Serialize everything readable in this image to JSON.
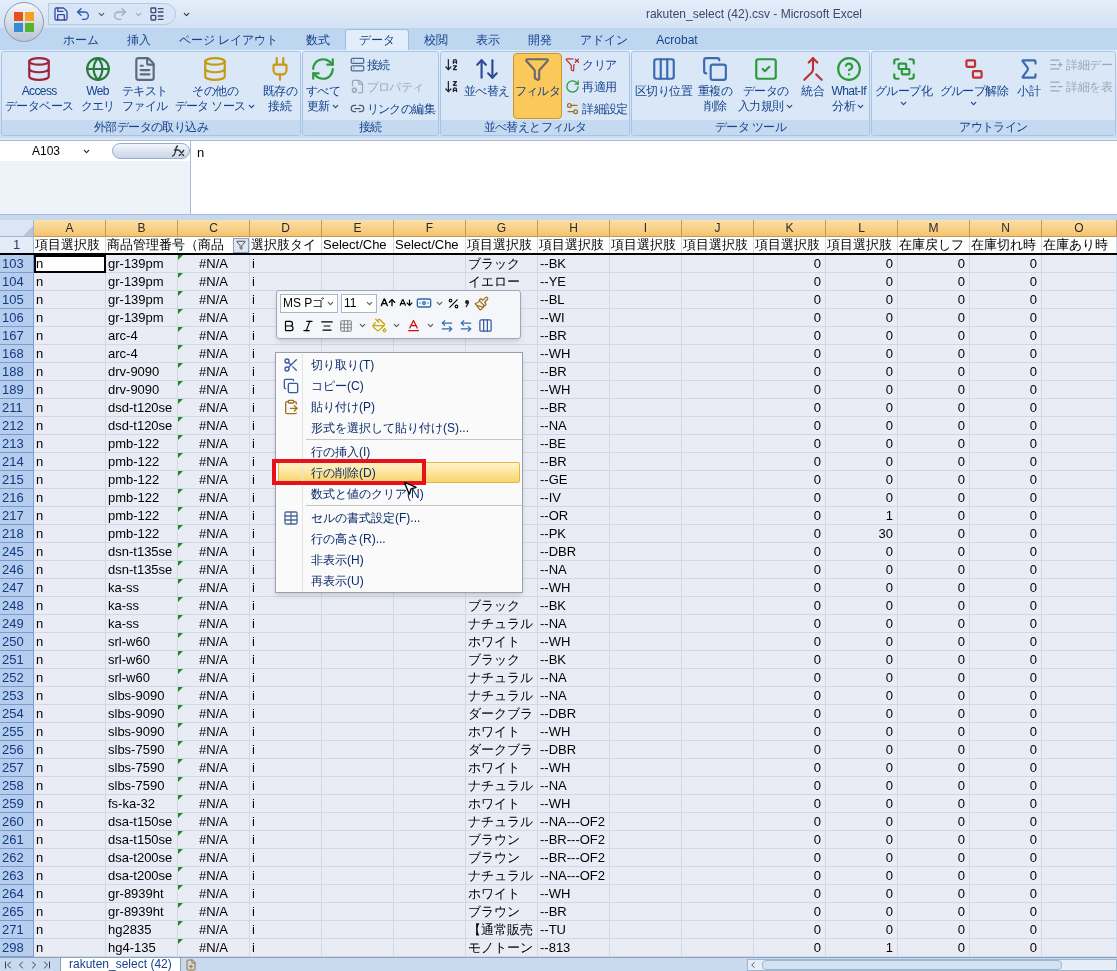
{
  "window": {
    "title": "rakuten_select (42).csv - Microsoft Excel"
  },
  "ribbon": {
    "tabs": [
      {
        "label": "ホーム",
        "selected": false
      },
      {
        "label": "挿入",
        "selected": false
      },
      {
        "label": "ページ レイアウト",
        "selected": false
      },
      {
        "label": "数式",
        "selected": false
      },
      {
        "label": "データ",
        "selected": true
      },
      {
        "label": "校閲",
        "selected": false
      },
      {
        "label": "表示",
        "selected": false
      },
      {
        "label": "開発",
        "selected": false
      },
      {
        "label": "アドイン",
        "selected": false
      },
      {
        "label": "Acrobat",
        "selected": false
      }
    ],
    "groups": [
      {
        "label": "外部データの取り込み",
        "buttons": [
          {
            "kind": "large",
            "lines": [
              "Access",
              "データベース"
            ],
            "dropdown": false,
            "disabled": false,
            "selected": false
          },
          {
            "kind": "large",
            "lines": [
              "Web",
              "クエリ"
            ],
            "dropdown": false,
            "disabled": false,
            "selected": false
          },
          {
            "kind": "large",
            "lines": [
              "テキスト",
              "ファイル"
            ],
            "dropdown": false,
            "disabled": false,
            "selected": false
          },
          {
            "kind": "large",
            "lines": [
              "その他の",
              "データ ソース"
            ],
            "dropdown": true,
            "disabled": false,
            "selected": false
          },
          {
            "kind": "large",
            "lines": [
              "既存の",
              "接続"
            ],
            "dropdown": false,
            "disabled": false,
            "selected": false
          }
        ]
      },
      {
        "label": "接続",
        "buttons": [
          {
            "kind": "large",
            "lines": [
              "すべて",
              "更新"
            ],
            "dropdown": true,
            "disabled": false,
            "selected": false
          },
          {
            "kind": "small",
            "lines": [
              "接続"
            ],
            "dropdown": false,
            "disabled": false,
            "selected": false
          },
          {
            "kind": "small",
            "lines": [
              "プロパティ"
            ],
            "dropdown": false,
            "disabled": true,
            "selected": false
          },
          {
            "kind": "small",
            "lines": [
              "リンクの編集"
            ],
            "dropdown": false,
            "disabled": false,
            "selected": false
          }
        ]
      },
      {
        "label": "並べ替えとフィルタ",
        "buttons": [
          {
            "kind": "small",
            "dropdown": false,
            "disabled": false,
            "selected": false
          },
          {
            "kind": "small",
            "dropdown": false,
            "disabled": false,
            "selected": false
          },
          {
            "kind": "large",
            "lines": [
              "並べ替え"
            ],
            "dropdown": false,
            "disabled": false,
            "selected": false
          },
          {
            "kind": "large",
            "lines": [
              "フィルタ"
            ],
            "dropdown": false,
            "disabled": false,
            "selected": true
          },
          {
            "kind": "small",
            "lines": [
              "クリア"
            ],
            "dropdown": false,
            "disabled": false,
            "selected": false
          },
          {
            "kind": "small",
            "lines": [
              "再適用"
            ],
            "dropdown": false,
            "disabled": false,
            "selected": false
          },
          {
            "kind": "small",
            "lines": [
              "詳細設定"
            ],
            "dropdown": false,
            "disabled": false,
            "selected": false
          }
        ]
      },
      {
        "label": "データ ツール",
        "buttons": [
          {
            "kind": "large",
            "lines": [
              "区切り位置"
            ],
            "dropdown": false,
            "disabled": false,
            "selected": false
          },
          {
            "kind": "large",
            "lines": [
              "重複の",
              "削除"
            ],
            "dropdown": false,
            "disabled": false,
            "selected": false
          },
          {
            "kind": "large",
            "lines": [
              "データの",
              "入力規則"
            ],
            "dropdown": true,
            "disabled": false,
            "selected": false
          },
          {
            "kind": "large",
            "lines": [
              "統合"
            ],
            "dropdown": false,
            "disabled": false,
            "selected": false
          },
          {
            "kind": "large",
            "lines": [
              "What-If",
              "分析"
            ],
            "dropdown": true,
            "disabled": false,
            "selected": false
          }
        ]
      },
      {
        "label": "アウトライン",
        "buttons": [
          {
            "kind": "large",
            "lines": [
              "グループ化"
            ],
            "dropdown": true,
            "disabled": false,
            "selected": false
          },
          {
            "kind": "large",
            "lines": [
              "グループ解除"
            ],
            "dropdown": true,
            "disabled": false,
            "selected": false
          },
          {
            "kind": "large",
            "lines": [
              "小計"
            ],
            "dropdown": false,
            "disabled": false,
            "selected": false
          },
          {
            "kind": "small",
            "lines": [
              "詳細デー"
            ],
            "dropdown": false,
            "disabled": true,
            "selected": false
          },
          {
            "kind": "small",
            "lines": [
              "詳細を表"
            ],
            "dropdown": false,
            "disabled": true,
            "selected": false
          }
        ]
      }
    ]
  },
  "formula_bar": {
    "name_box": "A103",
    "value": "n"
  },
  "columns": [
    {
      "label": "A",
      "selected": true
    },
    {
      "label": "B",
      "selected": true
    },
    {
      "label": "C",
      "selected": true
    },
    {
      "label": "D",
      "selected": true
    },
    {
      "label": "E",
      "selected": true
    },
    {
      "label": "F",
      "selected": true
    },
    {
      "label": "G",
      "selected": true
    },
    {
      "label": "H",
      "selected": true
    },
    {
      "label": "I",
      "selected": true
    },
    {
      "label": "J",
      "selected": true
    },
    {
      "label": "K",
      "selected": true
    },
    {
      "label": "L",
      "selected": true
    },
    {
      "label": "M",
      "selected": true
    },
    {
      "label": "N",
      "selected": true
    },
    {
      "label": "O",
      "selected": true
    }
  ],
  "header_row": {
    "num": "1",
    "cells": [
      {
        "text": "項目選択肢",
        "filter": false
      },
      {
        "text": "商品管理番号（商品",
        "filter": false
      },
      {
        "filter": true
      },
      {
        "text": "選択肢タイ",
        "filter": false
      },
      {
        "text": "Select/Che",
        "filter": false
      },
      {
        "text": "Select/Che",
        "filter": false
      },
      {
        "text": "項目選択肢",
        "filter": false
      },
      {
        "text": "項目選択肢",
        "filter": false
      },
      {
        "text": "項目選択肢",
        "filter": false
      },
      {
        "text": "項目選択肢",
        "filter": false
      },
      {
        "text": "項目選択肢",
        "filter": false
      },
      {
        "text": "項目選択肢",
        "filter": false
      },
      {
        "text": "在庫戻しフ",
        "filter": false
      },
      {
        "text": "在庫切れ時",
        "filter": false
      },
      {
        "text": "在庫あり時",
        "filter": false
      }
    ]
  },
  "rows": [
    {
      "num": "103",
      "selected": true,
      "active": true,
      "a": "n",
      "b": "gr-139pm",
      "c": "#N/A",
      "d": "i",
      "g": "ブラック",
      "h": "--BK",
      "k": "0",
      "l": "0",
      "m": "0",
      "n": "0"
    },
    {
      "num": "104",
      "selected": true,
      "active": false,
      "a": "n",
      "b": "gr-139pm",
      "c": "#N/A",
      "d": "i",
      "g": "イエロー",
      "h": "--YE",
      "k": "0",
      "l": "0",
      "m": "0",
      "n": "0"
    },
    {
      "num": "105",
      "selected": true,
      "active": false,
      "a": "n",
      "b": "gr-139pm",
      "c": "#N/A",
      "d": "i",
      "h": "--BL",
      "k": "0",
      "l": "0",
      "m": "0",
      "n": "0"
    },
    {
      "num": "106",
      "selected": true,
      "active": false,
      "a": "n",
      "b": "gr-139pm",
      "c": "#N/A",
      "d": "i",
      "h": "--WI",
      "k": "0",
      "l": "0",
      "m": "0",
      "n": "0"
    },
    {
      "num": "167",
      "selected": true,
      "active": false,
      "a": "n",
      "b": "arc-4",
      "c": "#N/A",
      "d": "i",
      "h": "--BR",
      "k": "0",
      "l": "0",
      "m": "0",
      "n": "0"
    },
    {
      "num": "168",
      "selected": true,
      "active": false,
      "a": "n",
      "b": "arc-4",
      "c": "#N/A",
      "d": "i",
      "h": "--WH",
      "k": "0",
      "l": "0",
      "m": "0",
      "n": "0"
    },
    {
      "num": "188",
      "selected": true,
      "active": false,
      "a": "n",
      "b": "drv-9090",
      "c": "#N/A",
      "d": "i",
      "h": "--BR",
      "k": "0",
      "l": "0",
      "m": "0",
      "n": "0"
    },
    {
      "num": "189",
      "selected": true,
      "active": false,
      "a": "n",
      "b": "drv-9090",
      "c": "#N/A",
      "d": "i",
      "h": "--WH",
      "k": "0",
      "l": "0",
      "m": "0",
      "n": "0"
    },
    {
      "num": "211",
      "selected": true,
      "active": false,
      "a": "n",
      "b": "dsd-t120se",
      "c": "#N/A",
      "d": "i",
      "h": "--BR",
      "k": "0",
      "l": "0",
      "m": "0",
      "n": "0"
    },
    {
      "num": "212",
      "selected": true,
      "active": false,
      "a": "n",
      "b": "dsd-t120se",
      "c": "#N/A",
      "d": "i",
      "h": "--NA",
      "k": "0",
      "l": "0",
      "m": "0",
      "n": "0"
    },
    {
      "num": "213",
      "selected": true,
      "active": false,
      "a": "n",
      "b": "pmb-122",
      "c": "#N/A",
      "d": "i",
      "h": "--BE",
      "k": "0",
      "l": "0",
      "m": "0",
      "n": "0"
    },
    {
      "num": "214",
      "selected": true,
      "active": false,
      "a": "n",
      "b": "pmb-122",
      "c": "#N/A",
      "d": "i",
      "h": "--BR",
      "k": "0",
      "l": "0",
      "m": "0",
      "n": "0"
    },
    {
      "num": "215",
      "selected": true,
      "active": false,
      "a": "n",
      "b": "pmb-122",
      "c": "#N/A",
      "d": "i",
      "h": "--GE",
      "k": "0",
      "l": "0",
      "m": "0",
      "n": "0"
    },
    {
      "num": "216",
      "selected": true,
      "active": false,
      "a": "n",
      "b": "pmb-122",
      "c": "#N/A",
      "d": "i",
      "h": "--IV",
      "k": "0",
      "l": "0",
      "m": "0",
      "n": "0"
    },
    {
      "num": "217",
      "selected": true,
      "active": false,
      "a": "n",
      "b": "pmb-122",
      "c": "#N/A",
      "d": "i",
      "h": "--OR",
      "k": "0",
      "l": "1",
      "m": "0",
      "n": "0"
    },
    {
      "num": "218",
      "selected": true,
      "active": false,
      "a": "n",
      "b": "pmb-122",
      "c": "#N/A",
      "d": "i",
      "h": "--PK",
      "k": "0",
      "l": "30",
      "m": "0",
      "n": "0"
    },
    {
      "num": "245",
      "selected": true,
      "active": false,
      "a": "n",
      "b": "dsn-t135se",
      "c": "#N/A",
      "d": "i",
      "h": "--DBR",
      "k": "0",
      "l": "0",
      "m": "0",
      "n": "0"
    },
    {
      "num": "246",
      "selected": true,
      "active": false,
      "a": "n",
      "b": "dsn-t135se",
      "c": "#N/A",
      "d": "i",
      "h": "--NA",
      "k": "0",
      "l": "0",
      "m": "0",
      "n": "0"
    },
    {
      "num": "247",
      "selected": true,
      "active": false,
      "a": "n",
      "b": "ka-ss",
      "c": "#N/A",
      "d": "i",
      "h": "--WH",
      "k": "0",
      "l": "0",
      "m": "0",
      "n": "0"
    },
    {
      "num": "248",
      "selected": true,
      "active": false,
      "a": "n",
      "b": "ka-ss",
      "c": "#N/A",
      "d": "i",
      "g": "ブラック",
      "h": "--BK",
      "k": "0",
      "l": "0",
      "m": "0",
      "n": "0"
    },
    {
      "num": "249",
      "selected": true,
      "active": false,
      "a": "n",
      "b": "ka-ss",
      "c": "#N/A",
      "d": "i",
      "g": "ナチュラル",
      "h": "--NA",
      "k": "0",
      "l": "0",
      "m": "0",
      "n": "0"
    },
    {
      "num": "250",
      "selected": true,
      "active": false,
      "a": "n",
      "b": "srl-w60",
      "c": "#N/A",
      "d": "i",
      "g": "ホワイト",
      "h": "--WH",
      "k": "0",
      "l": "0",
      "m": "0",
      "n": "0"
    },
    {
      "num": "251",
      "selected": true,
      "active": false,
      "a": "n",
      "b": "srl-w60",
      "c": "#N/A",
      "d": "i",
      "g": "ブラック",
      "h": "--BK",
      "k": "0",
      "l": "0",
      "m": "0",
      "n": "0"
    },
    {
      "num": "252",
      "selected": true,
      "active": false,
      "a": "n",
      "b": "srl-w60",
      "c": "#N/A",
      "d": "i",
      "g": "ナチュラル",
      "h": "--NA",
      "k": "0",
      "l": "0",
      "m": "0",
      "n": "0"
    },
    {
      "num": "253",
      "selected": true,
      "active": false,
      "a": "n",
      "b": "slbs-9090",
      "c": "#N/A",
      "d": "i",
      "g": "ナチュラル",
      "h": "--NA",
      "k": "0",
      "l": "0",
      "m": "0",
      "n": "0"
    },
    {
      "num": "254",
      "selected": true,
      "active": false,
      "a": "n",
      "b": "slbs-9090",
      "c": "#N/A",
      "d": "i",
      "g": "ダークブラ",
      "h": "--DBR",
      "k": "0",
      "l": "0",
      "m": "0",
      "n": "0"
    },
    {
      "num": "255",
      "selected": true,
      "active": false,
      "a": "n",
      "b": "slbs-9090",
      "c": "#N/A",
      "d": "i",
      "g": "ホワイト",
      "h": "--WH",
      "k": "0",
      "l": "0",
      "m": "0",
      "n": "0"
    },
    {
      "num": "256",
      "selected": true,
      "active": false,
      "a": "n",
      "b": "slbs-7590",
      "c": "#N/A",
      "d": "i",
      "g": "ダークブラ",
      "h": "--DBR",
      "k": "0",
      "l": "0",
      "m": "0",
      "n": "0"
    },
    {
      "num": "257",
      "selected": true,
      "active": false,
      "a": "n",
      "b": "slbs-7590",
      "c": "#N/A",
      "d": "i",
      "g": "ホワイト",
      "h": "--WH",
      "k": "0",
      "l": "0",
      "m": "0",
      "n": "0"
    },
    {
      "num": "258",
      "selected": true,
      "active": false,
      "a": "n",
      "b": "slbs-7590",
      "c": "#N/A",
      "d": "i",
      "g": "ナチュラル",
      "h": "--NA",
      "k": "0",
      "l": "0",
      "m": "0",
      "n": "0"
    },
    {
      "num": "259",
      "selected": true,
      "active": false,
      "a": "n",
      "b": "fs-ka-32",
      "c": "#N/A",
      "d": "i",
      "g": "ホワイト",
      "h": "--WH",
      "k": "0",
      "l": "0",
      "m": "0",
      "n": "0"
    },
    {
      "num": "260",
      "selected": true,
      "active": false,
      "a": "n",
      "b": "dsa-t150se",
      "c": "#N/A",
      "d": "i",
      "g": "ナチュラル",
      "h": "--NA---OF2",
      "k": "0",
      "l": "0",
      "m": "0",
      "n": "0"
    },
    {
      "num": "261",
      "selected": true,
      "active": false,
      "a": "n",
      "b": "dsa-t150se",
      "c": "#N/A",
      "d": "i",
      "g": "ブラウン",
      "h": "--BR---OF2",
      "k": "0",
      "l": "0",
      "m": "0",
      "n": "0"
    },
    {
      "num": "262",
      "selected": true,
      "active": false,
      "a": "n",
      "b": "dsa-t200se",
      "c": "#N/A",
      "d": "i",
      "g": "ブラウン",
      "h": "--BR---OF2",
      "k": "0",
      "l": "0",
      "m": "0",
      "n": "0"
    },
    {
      "num": "263",
      "selected": true,
      "active": false,
      "a": "n",
      "b": "dsa-t200se",
      "c": "#N/A",
      "d": "i",
      "g": "ナチュラル",
      "h": "--NA---OF2",
      "k": "0",
      "l": "0",
      "m": "0",
      "n": "0"
    },
    {
      "num": "264",
      "selected": true,
      "active": false,
      "a": "n",
      "b": "gr-8939ht",
      "c": "#N/A",
      "d": "i",
      "g": "ホワイト",
      "h": "--WH",
      "k": "0",
      "l": "0",
      "m": "0",
      "n": "0"
    },
    {
      "num": "265",
      "selected": true,
      "active": false,
      "a": "n",
      "b": "gr-8939ht",
      "c": "#N/A",
      "d": "i",
      "g": "ブラウン",
      "h": "--BR",
      "k": "0",
      "l": "0",
      "m": "0",
      "n": "0"
    },
    {
      "num": "271",
      "selected": true,
      "active": false,
      "a": "n",
      "b": "hg2835",
      "c": "#N/A",
      "d": "i",
      "g": "【通常販売",
      "h": "--TU",
      "k": "0",
      "l": "0",
      "m": "0",
      "n": "0"
    },
    {
      "num": "298",
      "selected": true,
      "active": false,
      "a": "n",
      "b": "hg4-135",
      "c": "#N/A",
      "d": "i",
      "g": "モノトーン",
      "h": "--813",
      "k": "0",
      "l": "1",
      "m": "0",
      "n": "0"
    }
  ],
  "mini_toolbar": {
    "font": "MS Pゴ",
    "size": "11"
  },
  "context_menu": {
    "items": [
      {
        "label": "切り取り(T)",
        "selected": false,
        "separator_before": false
      },
      {
        "label": "コピー(C)",
        "selected": false,
        "separator_before": false
      },
      {
        "label": "貼り付け(P)",
        "selected": false,
        "separator_before": false
      },
      {
        "label": "形式を選択して貼り付け(S)...",
        "selected": false,
        "separator_before": false
      },
      {
        "label": "行の挿入(I)",
        "selected": false,
        "separator_before": true
      },
      {
        "label": "行の削除(D)",
        "selected": true,
        "separator_before": false
      },
      {
        "label": "数式と値のクリア(N)",
        "selected": false,
        "separator_before": false
      },
      {
        "label": "セルの書式設定(F)...",
        "selected": false,
        "separator_before": true
      },
      {
        "label": "行の高さ(R)...",
        "selected": false,
        "separator_before": false
      },
      {
        "label": "非表示(H)",
        "selected": false,
        "separator_before": false
      },
      {
        "label": "再表示(U)",
        "selected": false,
        "separator_before": false
      }
    ]
  },
  "sheet_tabs": [
    {
      "label": "rakuten_select (42)",
      "selected": true
    }
  ]
}
